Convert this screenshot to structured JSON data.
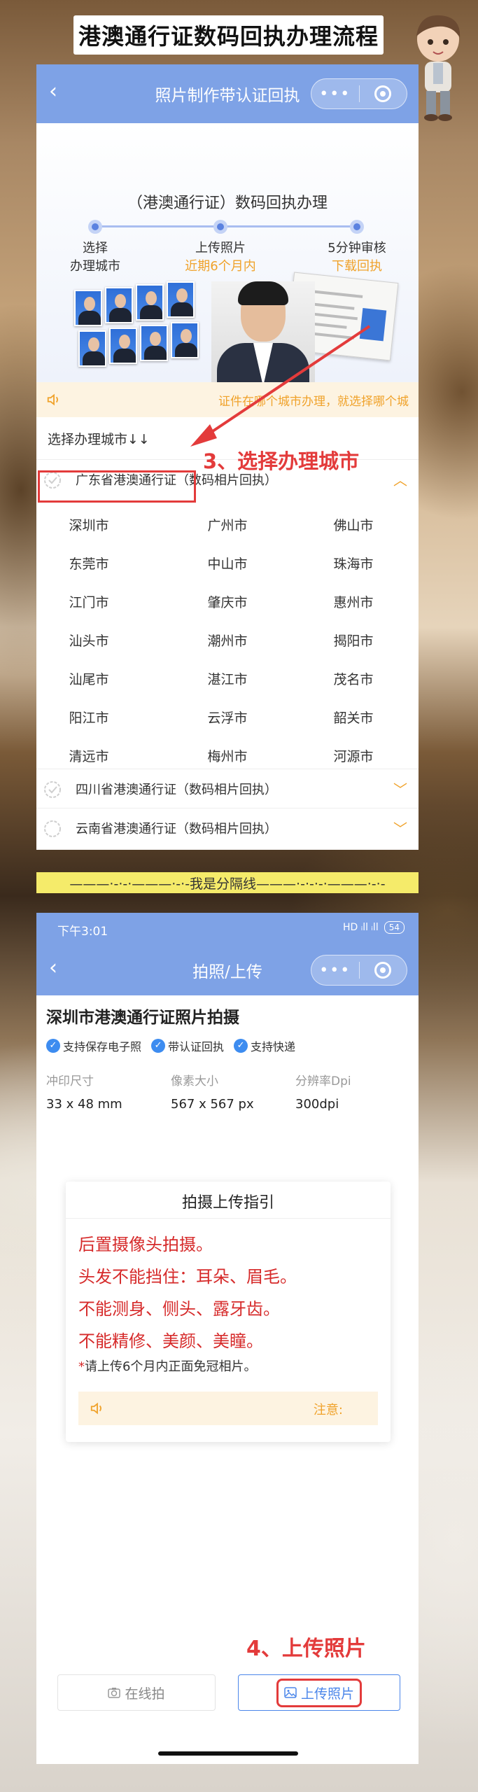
{
  "banner": {
    "title": "港澳通行证数码回执办理流程"
  },
  "panel1": {
    "nav": {
      "back": "‹",
      "title": "照片制作带认证回执",
      "dots": "•••"
    },
    "hero": {
      "title": "（港澳通行证）数码回执办理",
      "steps": [
        {
          "label": "选择",
          "sub": "办理城市"
        },
        {
          "label": "上传照片",
          "sub": "近期6个月内"
        },
        {
          "label": "5分钟审核",
          "sub": "下载回执"
        }
      ]
    },
    "notice": "证件在哪个城市办理，就选择哪个城",
    "city_label": "选择办理城市↓↓",
    "provinces": [
      {
        "name": "广东省港澳通行证（数码相片回执）",
        "chevron": "︿"
      },
      {
        "name": "四川省港澳通行证（数码相片回执）",
        "chevron": "﹀"
      },
      {
        "name": "云南省港澳通行证（数码相片回执）",
        "chevron": "﹀"
      }
    ],
    "cities": [
      "深圳市",
      "广州市",
      "佛山市",
      "东莞市",
      "中山市",
      "珠海市",
      "江门市",
      "肇庆市",
      "惠州市",
      "汕头市",
      "潮州市",
      "揭阳市",
      "汕尾市",
      "湛江市",
      "茂名市",
      "阳江市",
      "云浮市",
      "韶关市",
      "清远市",
      "梅州市",
      "河源市"
    ],
    "annotation": "3、选择办理城市"
  },
  "divider": "———·-·-·———·-·-我是分隔线———·-·-·-·———·-·-",
  "panel2": {
    "status": {
      "time": "下午3:01",
      "signal": "HD ᵢll ᵢll",
      "battery": "54"
    },
    "nav": {
      "back": "‹",
      "title": "拍照/上传",
      "dots": "•••"
    },
    "section_title": "深圳市港澳通行证照片拍摄",
    "features": [
      "支持保存电子照",
      "带认证回执",
      "支持快递"
    ],
    "specs": [
      {
        "key": "冲印尺寸",
        "value": "33 x 48 mm"
      },
      {
        "key": "像素大小",
        "value": "567 x 567 px"
      },
      {
        "key": "分辨率Dpi",
        "value": "300dpi"
      }
    ],
    "guide": {
      "title": "拍摄上传指引",
      "rules": [
        "后置摄像头拍摄。",
        "头发不能挡住：耳朵、眉毛。",
        "不能测身、侧头、露牙齿。",
        "不能精修、美颜、美瞳。"
      ],
      "note_star": "*",
      "note": "请上传6个月内正面免冠相片。",
      "notice": "注意:"
    },
    "annotation": "4、上传照片",
    "buttons": {
      "shoot": "在线拍",
      "upload": "上传照片"
    }
  },
  "colors": {
    "nav_blue": "#7ea2e6",
    "accent_orange": "#f0a22a",
    "annotation_red": "#e33b3b",
    "link_blue": "#4b86ea"
  }
}
